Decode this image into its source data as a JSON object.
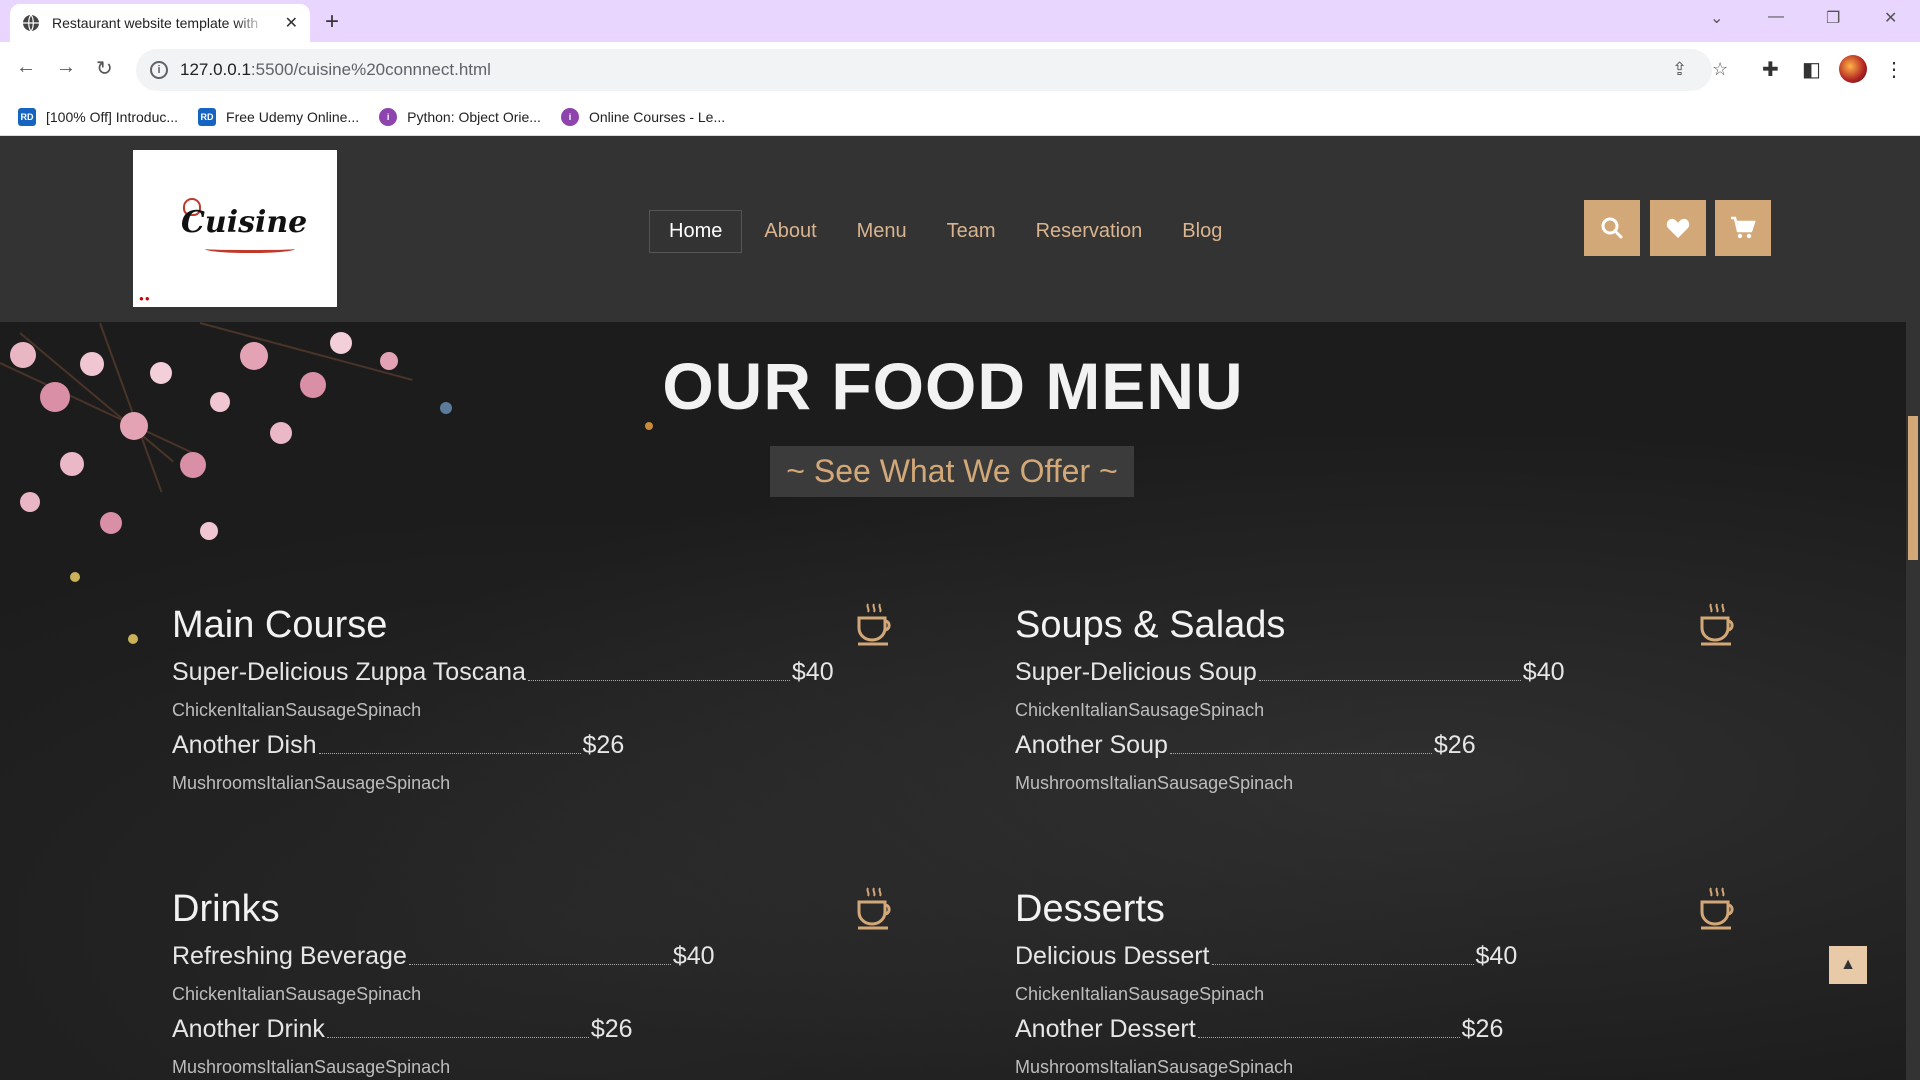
{
  "browser": {
    "tab_title": "Restaurant website template with",
    "url_host": "127.0.0.1",
    "url_rest": ":5500/cuisine%20connnect.html",
    "bookmarks": [
      {
        "label": "[100% Off] Introduc...",
        "icon": "rd-favicon",
        "badge": "RD"
      },
      {
        "label": "Free Udemy Online...",
        "icon": "rd-favicon",
        "badge": "RD"
      },
      {
        "label": "Python: Object Orie...",
        "icon": "purple-favicon",
        "badge": "i"
      },
      {
        "label": "Online Courses - Le...",
        "icon": "purple-favicon",
        "badge": "i"
      }
    ]
  },
  "site": {
    "logo_text": "Cuisine",
    "nav": [
      "Home",
      "About",
      "Menu",
      "Team",
      "Reservation",
      "Blog"
    ],
    "active_nav": "Home",
    "header_buttons": [
      "search-icon",
      "heart-icon",
      "cart-icon"
    ],
    "accent_color": "#d3a878"
  },
  "menu": {
    "title": "OUR FOOD MENU",
    "subtitle": "~ See What We Offer ~",
    "categories": [
      {
        "title": "Main Course",
        "items": [
          {
            "name": "Super-Delicious Zuppa Toscana",
            "price": "$40",
            "desc": "ChickenItalianSausageSpinach"
          },
          {
            "name": "Another Dish",
            "price": "$26",
            "desc": "MushroomsItalianSausageSpinach"
          }
        ]
      },
      {
        "title": "Soups & Salads",
        "items": [
          {
            "name": "Super-Delicious Soup",
            "price": "$40",
            "desc": "ChickenItalianSausageSpinach"
          },
          {
            "name": "Another Soup",
            "price": "$26",
            "desc": "MushroomsItalianSausageSpinach"
          }
        ]
      },
      {
        "title": "Drinks",
        "items": [
          {
            "name": "Refreshing Beverage",
            "price": "$40",
            "desc": "ChickenItalianSausageSpinach"
          },
          {
            "name": "Another Drink",
            "price": "$26",
            "desc": "MushroomsItalianSausageSpinach"
          }
        ]
      },
      {
        "title": "Desserts",
        "items": [
          {
            "name": "Delicious Dessert",
            "price": "$40",
            "desc": "ChickenItalianSausageSpinach"
          },
          {
            "name": "Another Dessert",
            "price": "$26",
            "desc": "MushroomsItalianSausageSpinach"
          }
        ]
      }
    ]
  }
}
